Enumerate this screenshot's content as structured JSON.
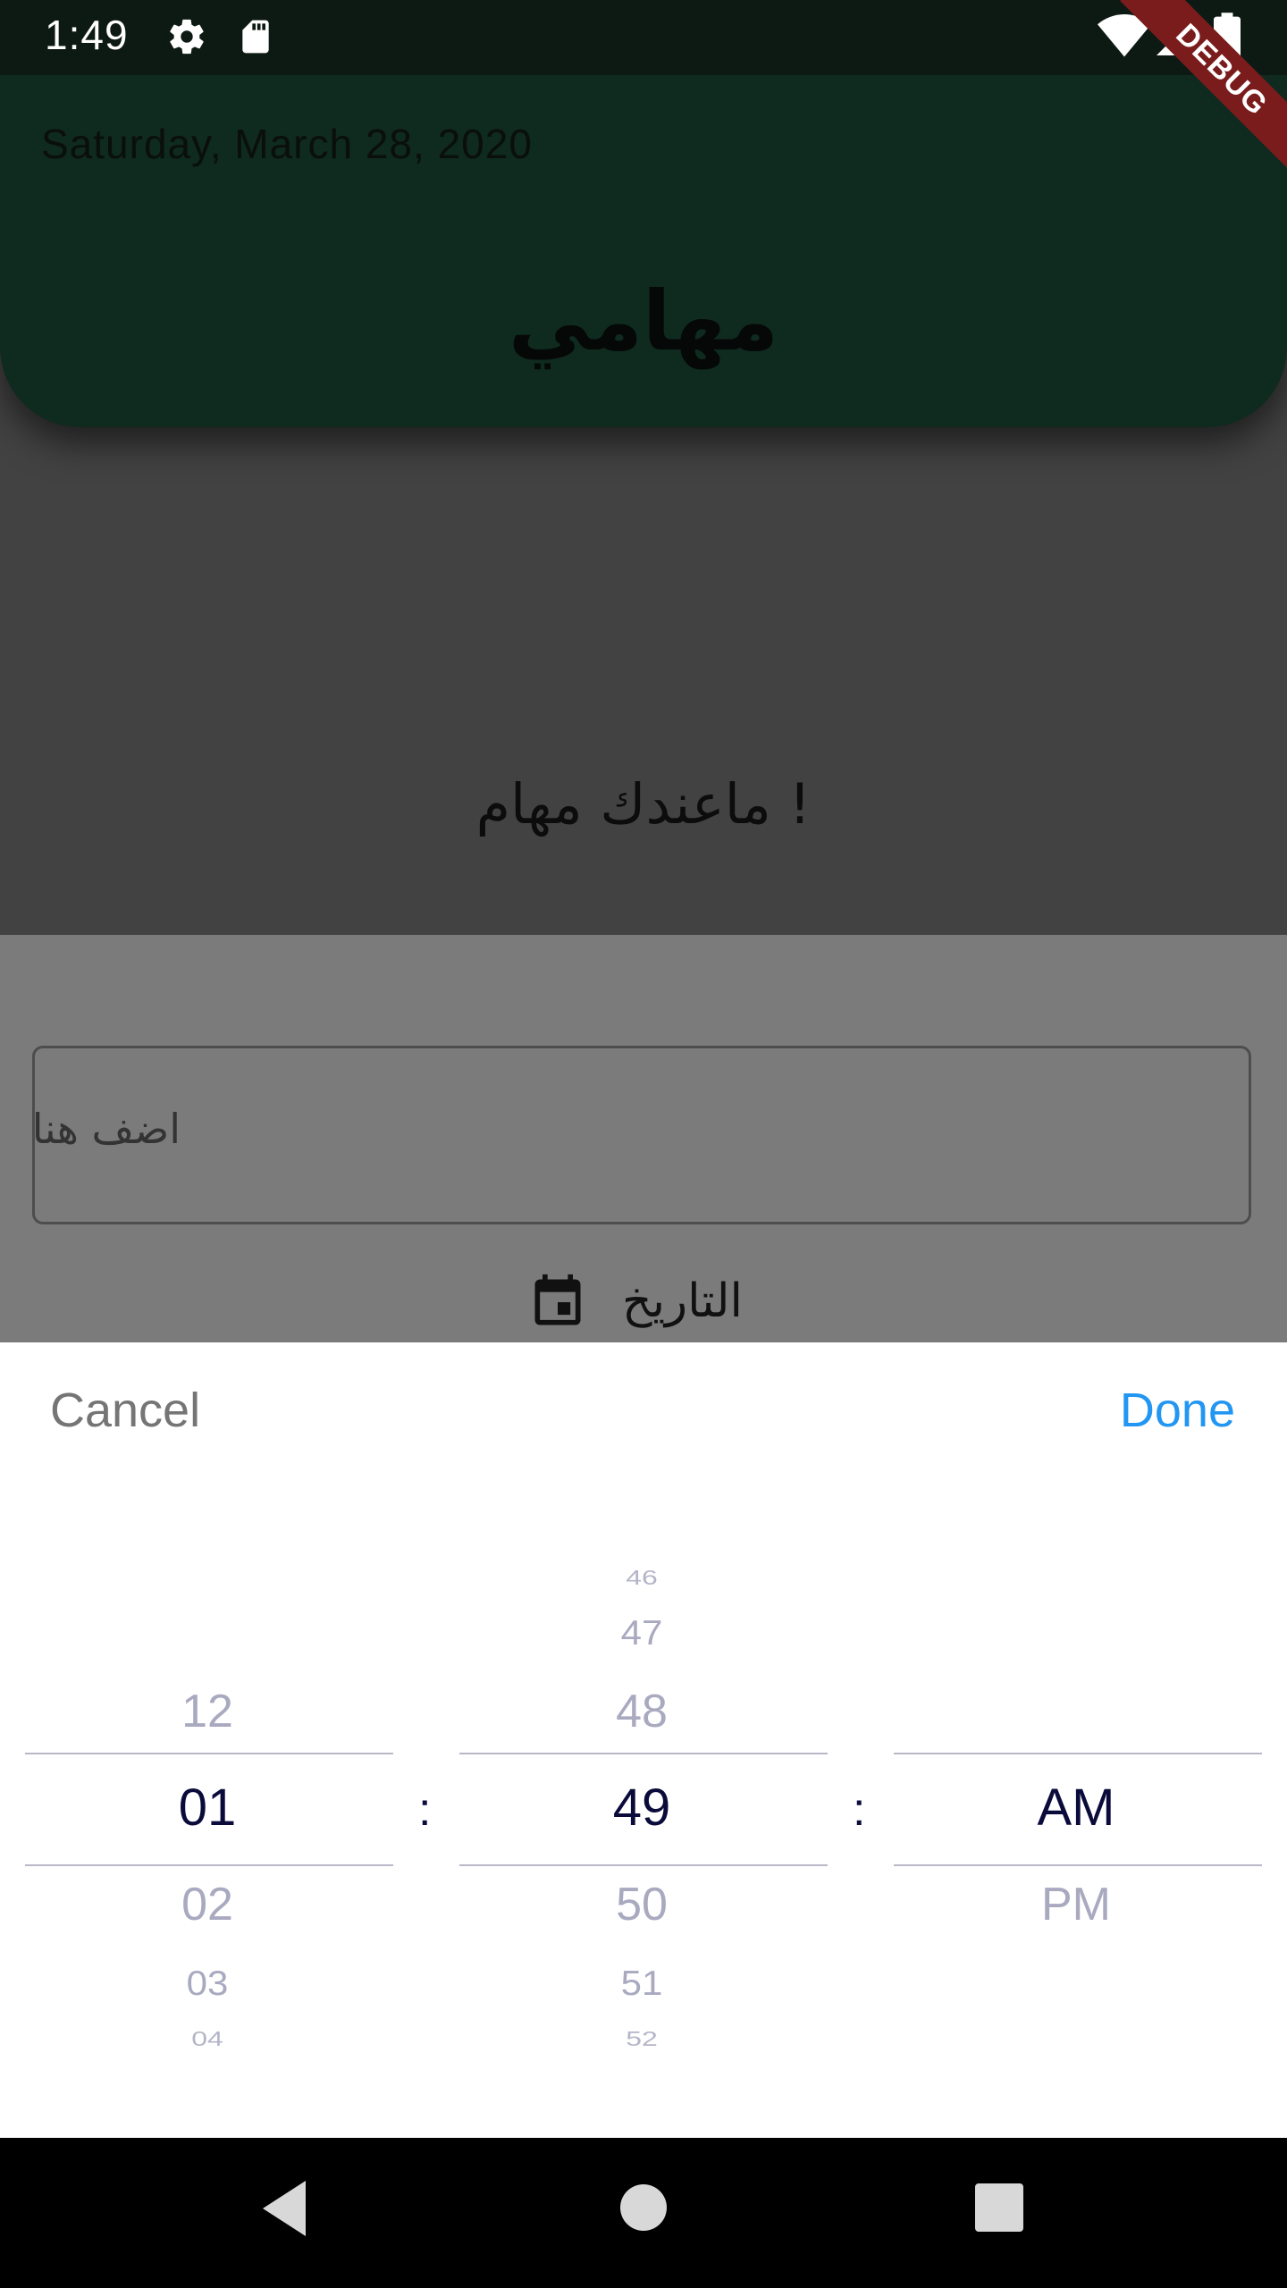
{
  "status_bar": {
    "time": "1:49",
    "left_icons": [
      "gear-icon",
      "sd-card-icon"
    ],
    "right_icons": [
      "wifi-icon",
      "cell-signal-icon",
      "battery-icon"
    ]
  },
  "debug_banner": "DEBUG",
  "header": {
    "date": "Saturday, March 28, 2020",
    "title": "مهامي"
  },
  "empty_state": "ماعندك مهام !",
  "task_form": {
    "placeholder": "اضف هنا",
    "date_label": "التاريخ",
    "date_icon": "calendar-icon"
  },
  "time_picker": {
    "cancel_label": "Cancel",
    "done_label": "Done",
    "separator": ":",
    "hour_items": [
      "12",
      "01",
      "02",
      "03",
      "04"
    ],
    "selected_hour": "01",
    "minute_items": [
      "46",
      "47",
      "48",
      "49",
      "50",
      "51",
      "52"
    ],
    "selected_minute": "49",
    "period_items": [
      "AM",
      "PM"
    ],
    "selected_period": "AM",
    "accent_color": "#2196f3",
    "selected_color": "#0b0b3b",
    "unselected_color": "#a9a9c0"
  },
  "nav_bar": {
    "buttons": [
      "back-icon",
      "home-icon",
      "recents-icon"
    ]
  }
}
